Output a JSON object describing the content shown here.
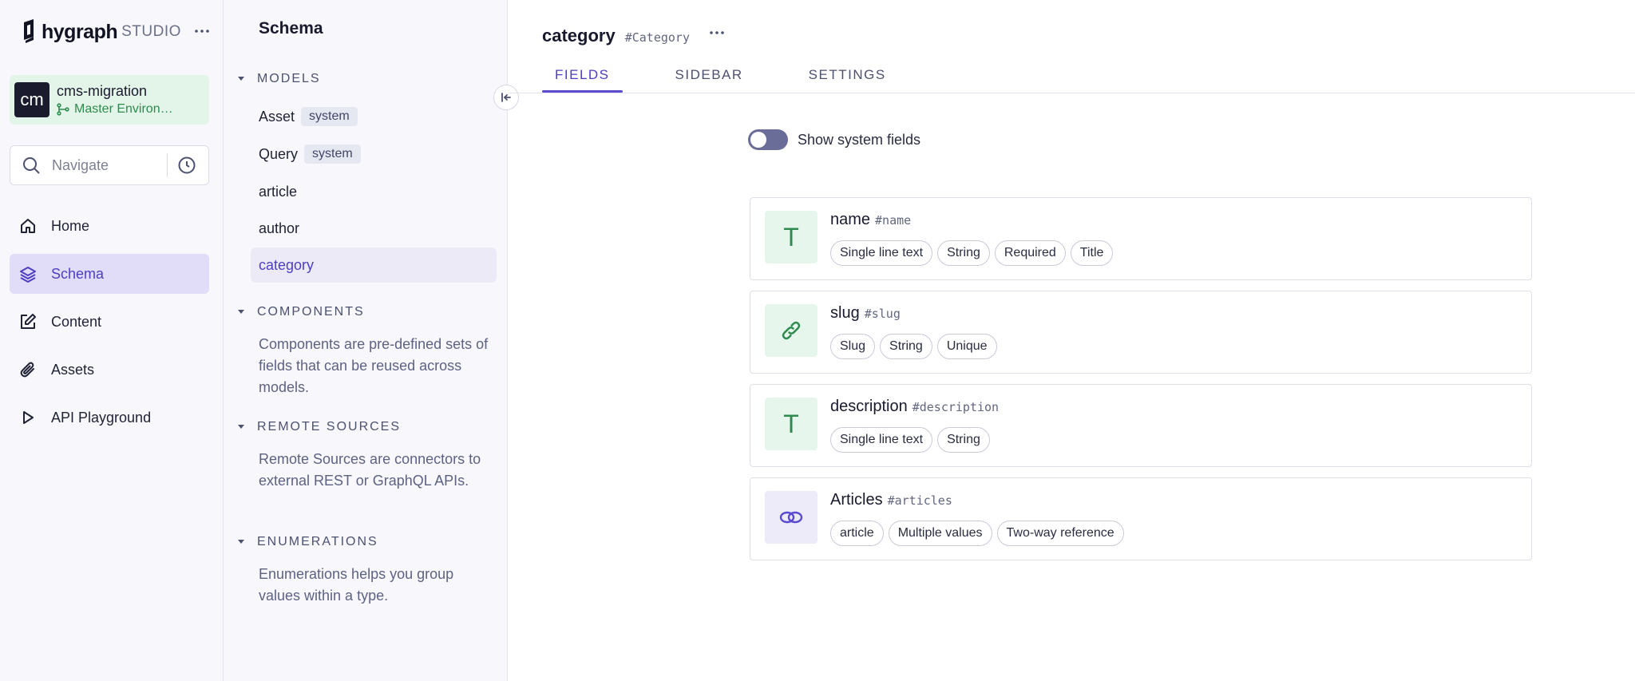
{
  "brand": {
    "name": "hygraph",
    "suffix": "STUDIO"
  },
  "project": {
    "avatar": "cm",
    "name": "cms-migration",
    "environment": "Master Environ…"
  },
  "search": {
    "placeholder": "Navigate"
  },
  "nav": [
    {
      "label": "Home",
      "icon": "home-icon"
    },
    {
      "label": "Schema",
      "icon": "layers-icon",
      "active": true
    },
    {
      "label": "Content",
      "icon": "edit-icon"
    },
    {
      "label": "Assets",
      "icon": "paperclip-icon"
    },
    {
      "label": "API Playground",
      "icon": "play-icon"
    }
  ],
  "schema": {
    "title": "Schema",
    "models_heading": "MODELS",
    "system_badge": "system",
    "models": [
      "Asset",
      "Query",
      "article",
      "author",
      "category"
    ],
    "components_heading": "COMPONENTS",
    "components_desc": "Components are pre-defined sets of fields that can be reused across models.",
    "remote_heading": "REMOTE SOURCES",
    "remote_desc": "Remote Sources are connectors to external REST or GraphQL APIs.",
    "enum_heading": "ENUMERATIONS",
    "enum_desc": "Enumerations helps you group values within a type."
  },
  "main": {
    "title": "category",
    "api_id": "#Category",
    "tabs": [
      "FIELDS",
      "SIDEBAR",
      "SETTINGS"
    ],
    "toggle_label": "Show system fields",
    "fields": [
      {
        "name": "name",
        "api": "#name",
        "icon": "text-icon",
        "tags": [
          "Single line text",
          "String",
          "Required",
          "Title"
        ]
      },
      {
        "name": "slug",
        "api": "#slug",
        "icon": "link-icon",
        "tags": [
          "Slug",
          "String",
          "Unique"
        ]
      },
      {
        "name": "description",
        "api": "#description",
        "icon": "text-icon",
        "tags": [
          "Single line text",
          "String"
        ]
      },
      {
        "name": "Articles",
        "api": "#articles",
        "icon": "reference-icon",
        "tags": [
          "article",
          "Multiple values",
          "Two-way reference"
        ]
      }
    ]
  },
  "colors": {
    "accent": "#5a4bd1",
    "green": "#2f8a4f",
    "active_bg": "#e1dcf7"
  }
}
